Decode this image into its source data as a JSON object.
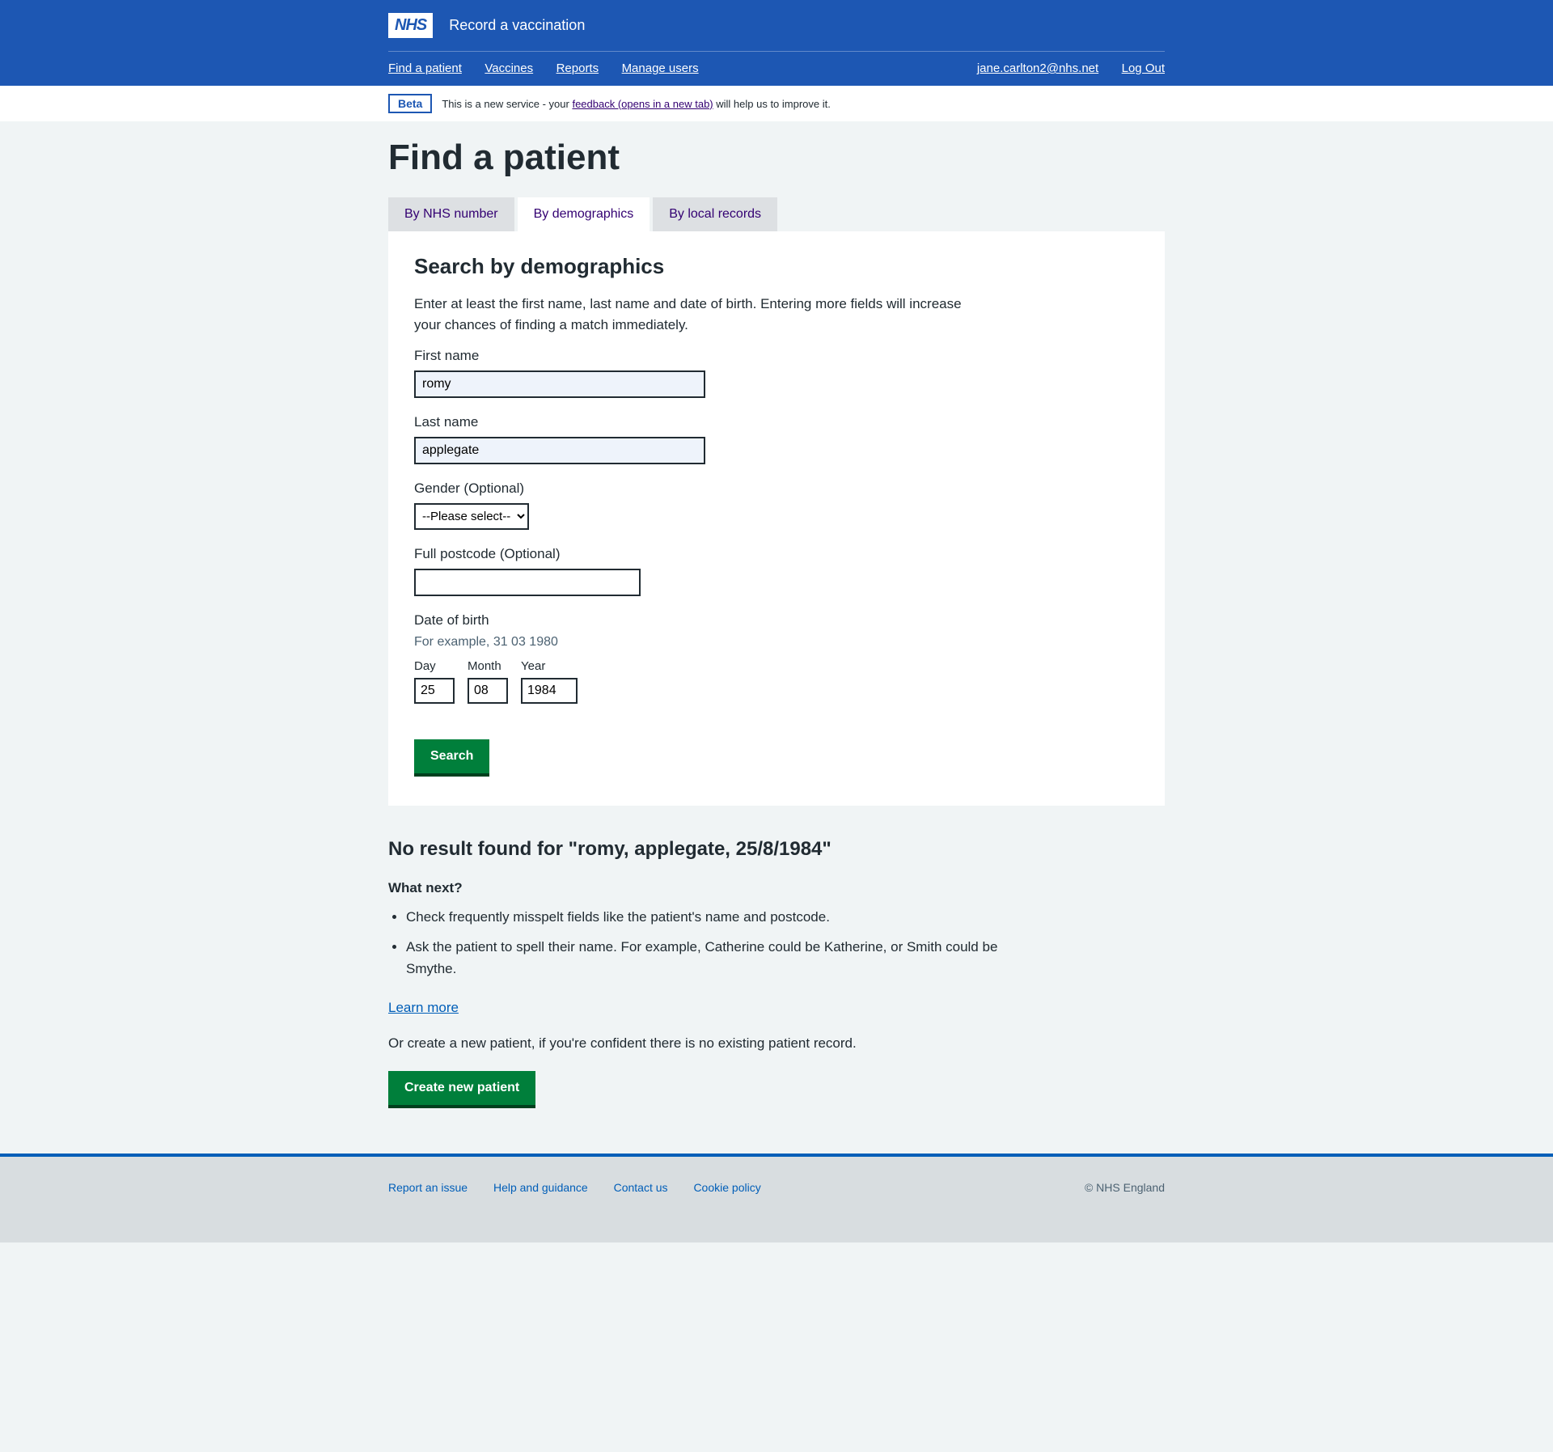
{
  "header": {
    "logo_text": "NHS",
    "service_name": "Record a vaccination",
    "nav": [
      "Find a patient",
      "Vaccines",
      "Reports",
      "Manage users"
    ],
    "user_email": "jane.carlton2@nhs.net",
    "logout": "Log Out"
  },
  "phase": {
    "tag": "Beta",
    "text_before": "This is a new service - your ",
    "link": "feedback (opens in a new tab)",
    "text_after": " will help us to improve it."
  },
  "page_title": "Find a patient",
  "tabs": [
    "By NHS number",
    "By demographics",
    "By local records"
  ],
  "panel": {
    "title": "Search by demographics",
    "description": "Enter at least the first name, last name and date of birth. Entering more fields will increase your chances of finding a match immediately.",
    "first_name_label": "First name",
    "first_name_value": "romy",
    "last_name_label": "Last name",
    "last_name_value": "applegate",
    "gender_label": "Gender (Optional)",
    "gender_selected": "--Please select--",
    "postcode_label": "Full postcode (Optional)",
    "postcode_value": "",
    "dob_label": "Date of birth",
    "dob_hint": "For example, 31 03 1980",
    "day_label": "Day",
    "day_value": "25",
    "month_label": "Month",
    "month_value": "08",
    "year_label": "Year",
    "year_value": "1984",
    "search_button": "Search"
  },
  "results": {
    "heading": "No result found for \"romy, applegate, 25/8/1984\"",
    "what_next": "What next?",
    "tips": [
      "Check frequently misspelt fields like the patient's name and postcode.",
      "Ask the patient to spell their name. For example, Catherine could be Katherine, or Smith could be Smythe."
    ],
    "learn_more": "Learn more",
    "or_text": "Or create a new patient, if you're confident there is no existing patient record.",
    "create_button": "Create new patient"
  },
  "footer": {
    "links": [
      "Report an issue",
      "Help and guidance",
      "Contact us",
      "Cookie policy"
    ],
    "copyright": "© NHS England"
  }
}
